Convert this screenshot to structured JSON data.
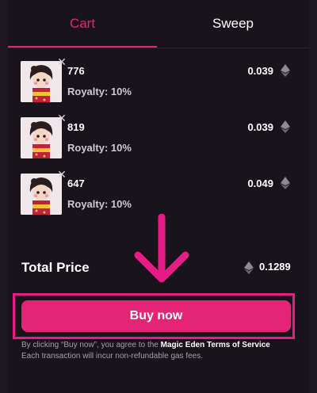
{
  "tabs": {
    "cart": "Cart",
    "sweep": "Sweep"
  },
  "items": [
    {
      "name": "776",
      "royalty": "Royalty: 10%",
      "price": "0.039",
      "currency_icon": "eth-icon"
    },
    {
      "name": "819",
      "royalty": "Royalty: 10%",
      "price": "0.039",
      "currency_icon": "eth-icon"
    },
    {
      "name": "647",
      "royalty": "Royalty: 10%",
      "price": "0.049",
      "currency_icon": "eth-icon"
    }
  ],
  "total": {
    "label": "Total Price",
    "value": "0.1289"
  },
  "buy_button": "Buy now",
  "disclaimer": {
    "prefix": "By clicking “Buy now”, you agree to the",
    "terms_link": "Magic Eden Terms of Service",
    "gas_note": "Each transaction will incur non-refundable gas fees."
  },
  "colors": {
    "accent": "#e42575",
    "highlight": "#e81c86",
    "background": "#19141b"
  }
}
